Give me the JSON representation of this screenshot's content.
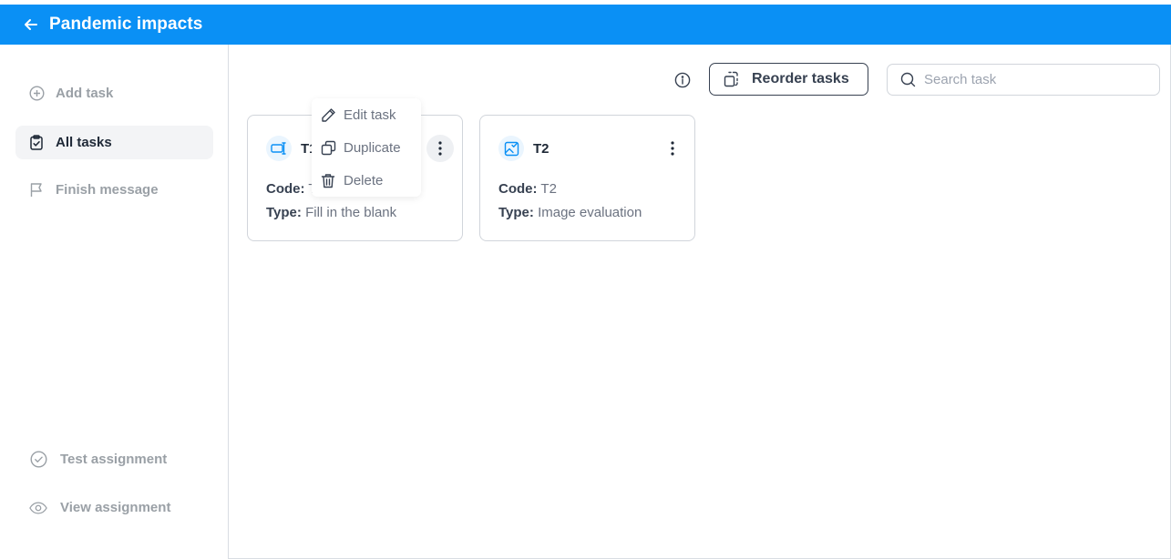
{
  "header": {
    "title": "Pandemic impacts"
  },
  "sidebar": {
    "items": [
      {
        "label": "Add task",
        "icon": "plus-circle-icon"
      },
      {
        "label": "All tasks",
        "icon": "clipboard-check-icon"
      },
      {
        "label": "Finish message",
        "icon": "flag-icon"
      }
    ],
    "bottom_items": [
      {
        "label": "Test assignment",
        "icon": "check-circle-icon"
      },
      {
        "label": "View assignment",
        "icon": "eye-icon"
      }
    ]
  },
  "toolbar": {
    "reorder_label": "Reorder tasks",
    "search_placeholder": "Search task"
  },
  "tasks": [
    {
      "title": "T1",
      "code_label": "Code:",
      "code": "T1",
      "type_label": "Type:",
      "type": "Fill in the blank",
      "icon": "fill-blank-icon"
    },
    {
      "title": "T2",
      "code_label": "Code:",
      "code": "T2",
      "type_label": "Type:",
      "type": "Image evaluation",
      "icon": "image-evaluation-icon"
    }
  ],
  "context_menu": {
    "items": [
      {
        "label": "Edit task",
        "icon": "pencil-icon"
      },
      {
        "label": "Duplicate",
        "icon": "duplicate-icon"
      },
      {
        "label": "Delete",
        "icon": "trash-icon"
      }
    ]
  },
  "colors": {
    "primary": "#0a90f5",
    "active_bg": "#f3f4f6",
    "muted": "#9aa0a6"
  }
}
